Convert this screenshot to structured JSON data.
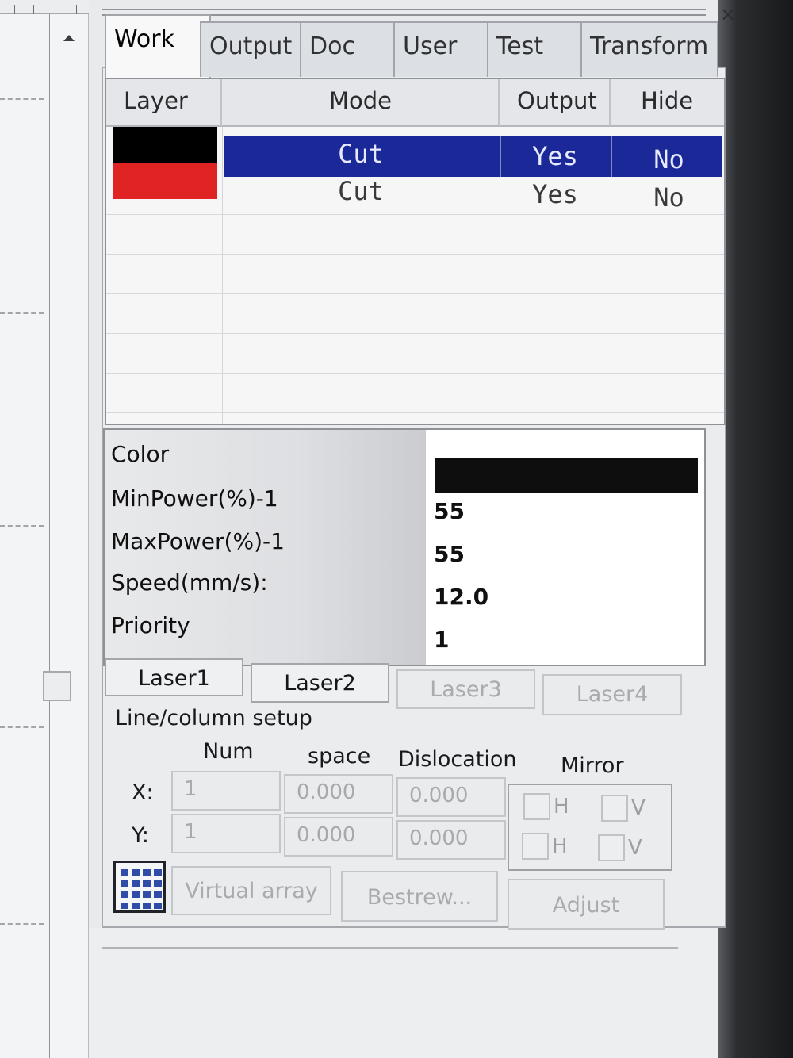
{
  "window": {
    "close_glyph": "×"
  },
  "tabs": [
    {
      "label": "Work",
      "active": true
    },
    {
      "label": "Output"
    },
    {
      "label": "Doc"
    },
    {
      "label": "User"
    },
    {
      "label": "Test"
    },
    {
      "label": "Transform"
    }
  ],
  "layer_table": {
    "columns": [
      "Layer",
      "Mode",
      "Output",
      "Hide"
    ],
    "rows": [
      {
        "color": "#000000",
        "mode": "Cut",
        "output": "Yes",
        "hide": "No",
        "selected": true
      },
      {
        "color": "#e02424",
        "mode": "Cut",
        "output": "Yes",
        "hide": "No",
        "selected": false
      }
    ]
  },
  "properties": {
    "color_label": "Color",
    "color_value": "#000000",
    "min_power_label": "MinPower(%)-1",
    "min_power_value": "55",
    "max_power_label": "MaxPower(%)-1",
    "max_power_value": "55",
    "speed_label": "Speed(mm/s):",
    "speed_value": "12.0",
    "priority_label": "Priority",
    "priority_value": "1"
  },
  "laser_buttons": [
    {
      "label": "Laser1",
      "enabled": true
    },
    {
      "label": "Laser2",
      "enabled": true
    },
    {
      "label": "Laser3",
      "enabled": false
    },
    {
      "label": "Laser4",
      "enabled": false
    }
  ],
  "array_setup": {
    "title": "Line/column setup",
    "col_num": "Num",
    "col_space": "space",
    "col_dislocation": "Dislocation",
    "col_mirror": "Mirror",
    "x_label": "X:",
    "y_label": "Y:",
    "x_num": "1",
    "x_space": "0.000",
    "x_dislocation": "0.000",
    "y_num": "1",
    "y_space": "0.000",
    "y_dislocation": "0.000",
    "mirror_h": "H",
    "mirror_v": "V"
  },
  "bottom_buttons": {
    "virtual_array": "Virtual array",
    "bestrew": "Bestrew...",
    "adjust": "Adjust"
  },
  "colors": {
    "selection": "#1b2898",
    "black_layer": "#000000",
    "red_layer": "#e02424"
  }
}
